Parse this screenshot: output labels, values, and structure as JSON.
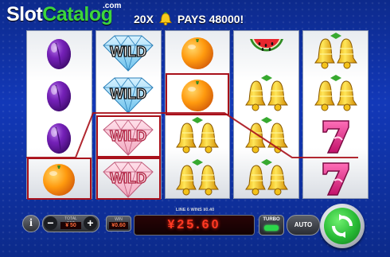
{
  "logo": {
    "slot": "Slot",
    "catalog": "Catalog",
    "com": ".com"
  },
  "header": {
    "multiplier": "20X",
    "pays": "PAYS 48000!"
  },
  "reels": [
    [
      {
        "symbol": "plum"
      },
      {
        "symbol": "plum"
      },
      {
        "symbol": "plum"
      },
      {
        "symbol": "orange",
        "highlight": true
      }
    ],
    [
      {
        "symbol": "wild-diamond",
        "label": "WILD"
      },
      {
        "symbol": "wild-diamond",
        "label": "WILD"
      },
      {
        "symbol": "wild-diamond",
        "label": "WILD",
        "highlight": true
      },
      {
        "symbol": "wild-diamond",
        "label": "WILD",
        "highlight": true
      }
    ],
    [
      {
        "symbol": "orange"
      },
      {
        "symbol": "orange",
        "highlight": true
      },
      {
        "symbol": "bell"
      },
      {
        "symbol": "bell"
      }
    ],
    [
      {
        "symbol": "watermelon"
      },
      {
        "symbol": "bell"
      },
      {
        "symbol": "bell"
      },
      {
        "symbol": "bell"
      }
    ],
    [
      {
        "symbol": "bell"
      },
      {
        "symbol": "bell"
      },
      {
        "symbol": "seven"
      },
      {
        "symbol": "seven"
      }
    ]
  ],
  "controls": {
    "info_label": "i",
    "minus_label": "−",
    "plus_label": "+",
    "bet_label": "TOTAL BET",
    "bet_value": "¥ 50",
    "win_label": "WIN",
    "win_value": "¥0.60",
    "line_info": "LINE 6 WINS ¥0.40",
    "balance": "¥25.60",
    "turbo_label": "TURBO",
    "auto_label": "AUTO"
  },
  "colors": {
    "highlight": "#a8101a",
    "accent_green": "#27b934",
    "display_red": "#ff3a24"
  }
}
